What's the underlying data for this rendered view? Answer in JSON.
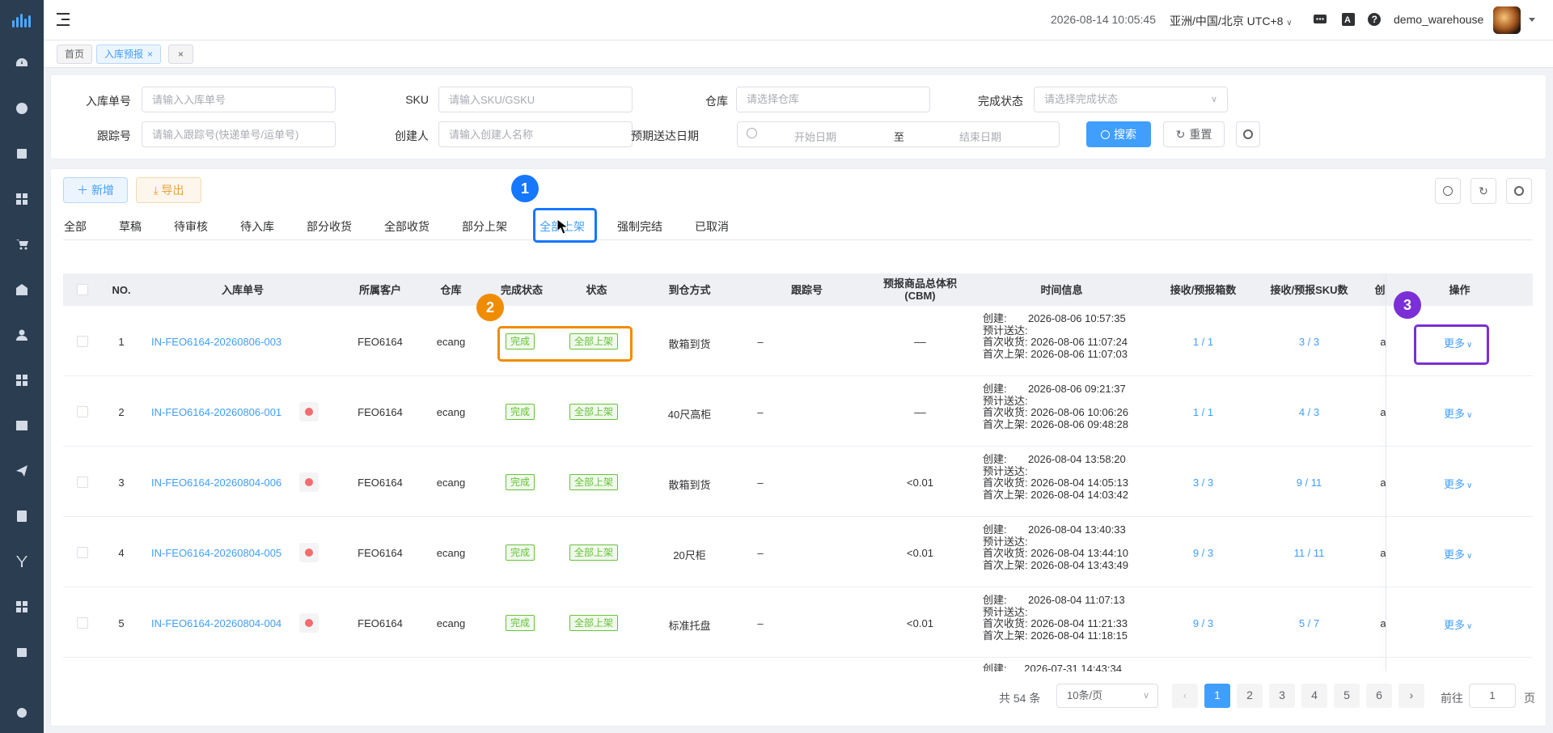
{
  "topbar": {
    "datetime": "2026-08-14 10:05:45",
    "timezone": "亚洲/中国/北京 UTC+8",
    "username": "demo_warehouse"
  },
  "tags": [
    {
      "label": "首页"
    },
    {
      "label": "入库预报"
    }
  ],
  "filters": {
    "inbound_no": {
      "label": "入库单号",
      "placeholder": "请输入入库单号"
    },
    "sku": {
      "label": "SKU",
      "placeholder": "请输入SKU/GSKU"
    },
    "warehouse": {
      "label": "仓库",
      "placeholder": "请选择仓库"
    },
    "completion": {
      "label": "完成状态",
      "placeholder": "请选择完成状态"
    },
    "tracking": {
      "label": "跟踪号",
      "placeholder": "请输入跟踪号(快递单号/运单号)"
    },
    "creator": {
      "label": "创建人",
      "placeholder": "请输入创建人名称"
    },
    "eta": {
      "label": "预期送达日期",
      "start": "开始日期",
      "sep": "至",
      "end": "结束日期"
    },
    "search_label": "搜索",
    "reset_label": "重置"
  },
  "toolbar": {
    "add_label": "新增",
    "export_label": "导出"
  },
  "status_tabs": [
    "全部",
    "草稿",
    "待审核",
    "待入库",
    "部分收货",
    "全部收货",
    "部分上架",
    "全部上架",
    "强制完结",
    "已取消"
  ],
  "active_tab_index": 7,
  "table": {
    "headers": {
      "no": "NO.",
      "inbound_no": "入库单号",
      "customer": "所属客户",
      "warehouse": "仓库",
      "completion": "完成状态",
      "status": "状态",
      "arrival": "到仓方式",
      "tracking": "跟踪号",
      "volume_1": "预报商品总体积",
      "volume_2": "(CBM)",
      "time": "时间信息",
      "boxes": "接收/预报箱数",
      "skus": "接收/预报SKU数",
      "creator_partial": "创",
      "ops": "操作"
    },
    "time_labels": {
      "created": "创建:",
      "eta": "预计送达:",
      "first_recv": "首次收货:",
      "first_shelf": "首次上架:"
    },
    "rows": [
      {
        "no": "1",
        "inbound_no": "IN-FEO6164-20260806-003",
        "warn": false,
        "customer": "FEO6164",
        "warehouse": "ecang",
        "completion": "完成",
        "status": "全部上架",
        "arrival": "散箱到货",
        "tracking": "–",
        "volume": "––",
        "created": "2026-08-06 10:57:35",
        "eta": "",
        "first_recv": "2026-08-06 11:07:24",
        "first_shelf": "2026-08-06 11:07:03",
        "boxes": "1 / 1",
        "skus": "3 / 3",
        "creator_partial": "a",
        "more": "更多"
      },
      {
        "no": "2",
        "inbound_no": "IN-FEO6164-20260806-001",
        "warn": true,
        "customer": "FEO6164",
        "warehouse": "ecang",
        "completion": "完成",
        "status": "全部上架",
        "arrival": "40尺高柜",
        "tracking": "–",
        "volume": "––",
        "created": "2026-08-06 09:21:37",
        "eta": "",
        "first_recv": "2026-08-06 10:06:26",
        "first_shelf": "2026-08-06 09:48:28",
        "boxes": "1 / 1",
        "skus": "4 / 3",
        "creator_partial": "a",
        "more": "更多"
      },
      {
        "no": "3",
        "inbound_no": "IN-FEO6164-20260804-006",
        "warn": true,
        "customer": "FEO6164",
        "warehouse": "ecang",
        "completion": "完成",
        "status": "全部上架",
        "arrival": "散箱到货",
        "tracking": "–",
        "volume": "<0.01",
        "created": "2026-08-04 13:58:20",
        "eta": "",
        "first_recv": "2026-08-04 14:05:13",
        "first_shelf": "2026-08-04 14:03:42",
        "boxes": "3 / 3",
        "skus": "9 / 11",
        "creator_partial": "a",
        "more": "更多"
      },
      {
        "no": "4",
        "inbound_no": "IN-FEO6164-20260804-005",
        "warn": true,
        "customer": "FEO6164",
        "warehouse": "ecang",
        "completion": "完成",
        "status": "全部上架",
        "arrival": "20尺柜",
        "tracking": "–",
        "volume": "<0.01",
        "created": "2026-08-04 13:40:33",
        "eta": "",
        "first_recv": "2026-08-04 13:44:10",
        "first_shelf": "2026-08-04 13:43:49",
        "boxes": "9 / 3",
        "skus": "11 / 11",
        "creator_partial": "a",
        "more": "更多"
      },
      {
        "no": "5",
        "inbound_no": "IN-FEO6164-20260804-004",
        "warn": true,
        "customer": "FEO6164",
        "warehouse": "ecang",
        "completion": "完成",
        "status": "全部上架",
        "arrival": "标准托盘",
        "tracking": "–",
        "volume": "<0.01",
        "created": "2026-08-04 11:07:13",
        "eta": "",
        "first_recv": "2026-08-04 11:21:33",
        "first_shelf": "2026-08-04 11:18:15",
        "boxes": "9 / 3",
        "skus": "5 / 7",
        "creator_partial": "a",
        "more": "更多"
      }
    ],
    "partial_row_created": "2026-07-31 14:43:34"
  },
  "pagination": {
    "total": "共 54 条",
    "page_size": "10条/页",
    "pages": [
      "1",
      "2",
      "3",
      "4",
      "5",
      "6"
    ],
    "current": "1",
    "goto_label": "前往",
    "goto_value": "1",
    "page_suffix": "页"
  },
  "annotations": [
    "1",
    "2",
    "3"
  ],
  "colors": {
    "sidebar": "#2b3d51",
    "primary": "#409eff",
    "success": "#67c23a",
    "annotation_blue": "#1677ff",
    "annotation_orange": "#f08c00",
    "annotation_purple": "#7b2fd6"
  }
}
